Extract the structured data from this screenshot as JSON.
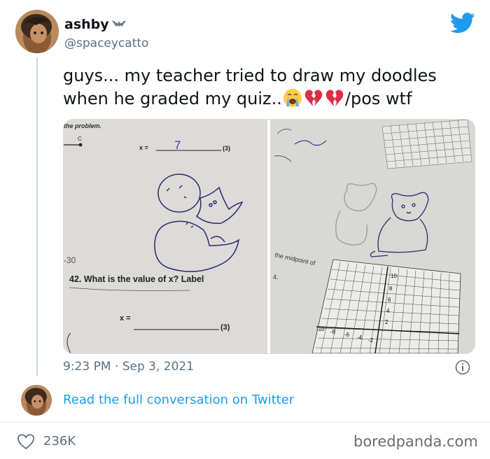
{
  "author": {
    "display_name": "ashby",
    "badge_icon": "bat-icon",
    "handle": "@spaceycatto"
  },
  "tweet": {
    "text_before_emoji": "guys... my teacher tried to draw my doodles when he graded my quiz..",
    "emojis": [
      "crying-face-icon",
      "broken-heart-icon",
      "broken-heart-icon"
    ],
    "text_after_emoji": "/pos wtf",
    "timestamp": "9:23 PM · Sep 3, 2021",
    "likes": "236K"
  },
  "left_photo": {
    "header": "the problem.",
    "x_eq_top": "x =",
    "answer_top": "7",
    "points_top": "(3)",
    "margin_note": "-30",
    "question": "42. What is the value of x? Label",
    "x_eq_bottom": "x =",
    "points_bottom": "(3)"
  },
  "right_photo": {
    "midpoint_note": "the midpoint of",
    "item_number": "4.",
    "grid_axis_labels": [
      "10",
      "8",
      "6",
      "4",
      "2",
      "-10",
      "-8",
      "-6",
      "-4",
      "-2"
    ]
  },
  "links": {
    "read_full": "Read the full conversation on Twitter"
  },
  "watermark": "boredpanda.com",
  "colors": {
    "twitter_blue": "#1d9bf0",
    "text_primary": "#0f1419",
    "text_secondary": "#5b7083"
  }
}
